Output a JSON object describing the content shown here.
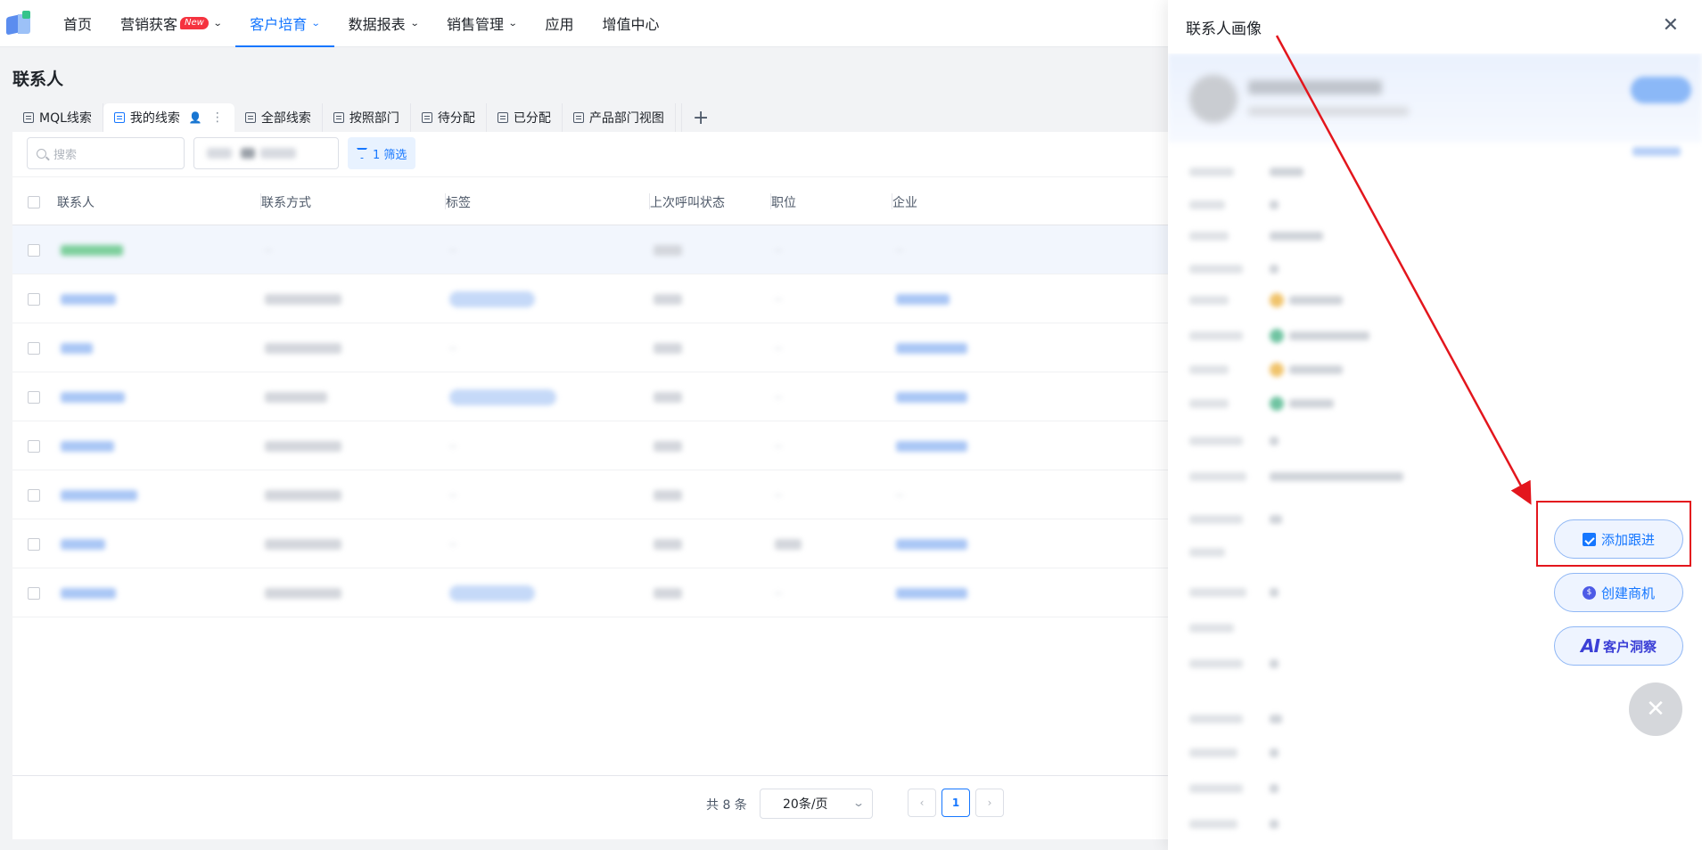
{
  "nav": {
    "items": [
      {
        "label": "首页",
        "has_chevron": false,
        "active": false
      },
      {
        "label": "营销获客",
        "badge": "New",
        "has_chevron": true,
        "active": false
      },
      {
        "label": "客户培育",
        "has_chevron": true,
        "active": true
      },
      {
        "label": "数据报表",
        "has_chevron": true,
        "active": false
      },
      {
        "label": "销售管理",
        "has_chevron": true,
        "active": false
      },
      {
        "label": "应用",
        "has_chevron": false,
        "active": false
      },
      {
        "label": "增值中心",
        "has_chevron": false,
        "active": false
      }
    ]
  },
  "page": {
    "title": "联系人",
    "view_tabs": [
      {
        "label": "MQL线索",
        "active": false
      },
      {
        "label": "我的线索",
        "active": true
      },
      {
        "label": "全部线索",
        "active": false
      },
      {
        "label": "按照部门",
        "active": false
      },
      {
        "label": "待分配",
        "active": false
      },
      {
        "label": "已分配",
        "active": false
      },
      {
        "label": "产品部门视图",
        "active": false
      }
    ],
    "add_tab_symbol": "+",
    "search_placeholder": "搜索",
    "filter_label": "1 筛选"
  },
  "table": {
    "columns": [
      "联系人",
      "联系方式",
      "标签",
      "上次呼叫状态",
      "职位",
      "企业"
    ],
    "rows": [
      {
        "highlight": true,
        "contact_w": 70,
        "phone_w": 0,
        "tag_w": 0,
        "status_w": 32,
        "title_w": 0,
        "company_w": 0
      },
      {
        "highlight": false,
        "contact_w": 62,
        "phone_w": 86,
        "tag_w": 96,
        "status_w": 32,
        "title_w": 0,
        "company_w": 60
      },
      {
        "highlight": false,
        "contact_w": 36,
        "phone_w": 86,
        "tag_w": 0,
        "status_w": 32,
        "title_w": 0,
        "company_w": 80
      },
      {
        "highlight": false,
        "contact_w": 72,
        "phone_w": 70,
        "tag_w": 120,
        "status_w": 32,
        "title_w": 0,
        "company_w": 80
      },
      {
        "highlight": false,
        "contact_w": 60,
        "phone_w": 86,
        "tag_w": 0,
        "status_w": 32,
        "title_w": 0,
        "company_w": 80
      },
      {
        "highlight": false,
        "contact_w": 86,
        "phone_w": 86,
        "tag_w": 0,
        "status_w": 32,
        "title_w": 0,
        "company_w": 0
      },
      {
        "highlight": false,
        "contact_w": 50,
        "phone_w": 86,
        "tag_w": 0,
        "status_w": 32,
        "title_w": 30,
        "company_w": 80
      },
      {
        "highlight": false,
        "contact_w": 62,
        "phone_w": 86,
        "tag_w": 96,
        "status_w": 32,
        "title_w": 0,
        "company_w": 80
      }
    ]
  },
  "pagination": {
    "total": "共 8 条",
    "page_size": "20条/页",
    "prev": "‹",
    "current": "1",
    "next": "›"
  },
  "drawer": {
    "title": "联系人画像",
    "close_symbol": "✕",
    "actions": {
      "add_followup": "添加跟进",
      "create_opportunity": "创建商机",
      "ai_badge": "AI",
      "customer_insight": "客户洞察"
    },
    "float_close_symbol": "✕"
  },
  "colors": {
    "primary": "#1677ff",
    "annotation": "#e3161d",
    "badge_new": "#f5333f"
  }
}
